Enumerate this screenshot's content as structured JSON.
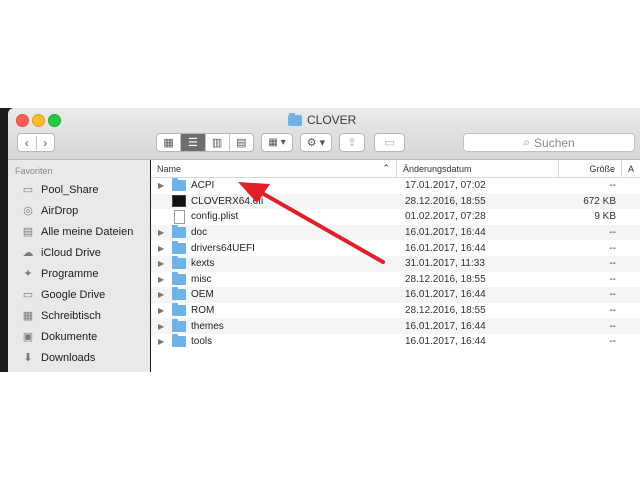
{
  "window": {
    "title": "CLOVER"
  },
  "toolbar": {
    "back": "‹",
    "forward": "›",
    "search_placeholder": "Suchen"
  },
  "sidebar": {
    "heading": "Favoriten",
    "items": [
      {
        "label": "Pool_Share",
        "icon": "folder-icon"
      },
      {
        "label": "AirDrop",
        "icon": "airdrop-icon"
      },
      {
        "label": "Alle meine Dateien",
        "icon": "all-files-icon"
      },
      {
        "label": "iCloud Drive",
        "icon": "cloud-icon"
      },
      {
        "label": "Programme",
        "icon": "applications-icon"
      },
      {
        "label": "Google Drive",
        "icon": "folder-icon"
      },
      {
        "label": "Schreibtisch",
        "icon": "desktop-icon"
      },
      {
        "label": "Dokumente",
        "icon": "documents-icon"
      },
      {
        "label": "Downloads",
        "icon": "downloads-icon"
      }
    ]
  },
  "columns": {
    "name": "Name",
    "date": "Änderungsdatum",
    "size": "Größe",
    "kind": "A"
  },
  "files": [
    {
      "name": "ACPI",
      "date": "17.01.2017, 07:02",
      "size": "--",
      "type": "folder",
      "expandable": true
    },
    {
      "name": "CLOVERX64.efi",
      "date": "28.12.2016, 18:55",
      "size": "672 KB",
      "type": "exec",
      "expandable": false
    },
    {
      "name": "config.plist",
      "date": "01.02.2017, 07:28",
      "size": "9 KB",
      "type": "file",
      "expandable": false
    },
    {
      "name": "doc",
      "date": "16.01.2017, 16:44",
      "size": "--",
      "type": "folder",
      "expandable": true
    },
    {
      "name": "drivers64UEFI",
      "date": "16.01.2017, 16:44",
      "size": "--",
      "type": "folder",
      "expandable": true
    },
    {
      "name": "kexts",
      "date": "31.01.2017, 11:33",
      "size": "--",
      "type": "folder",
      "expandable": true
    },
    {
      "name": "misc",
      "date": "28.12.2016, 18:55",
      "size": "--",
      "type": "folder",
      "expandable": true
    },
    {
      "name": "OEM",
      "date": "16.01.2017, 16:44",
      "size": "--",
      "type": "folder",
      "expandable": true
    },
    {
      "name": "ROM",
      "date": "28.12.2016, 18:55",
      "size": "--",
      "type": "folder",
      "expandable": true
    },
    {
      "name": "themes",
      "date": "16.01.2017, 16:44",
      "size": "--",
      "type": "folder",
      "expandable": true
    },
    {
      "name": "tools",
      "date": "16.01.2017, 16:44",
      "size": "--",
      "type": "folder",
      "expandable": true
    }
  ],
  "colors": {
    "annotation_arrow": "#e0202a",
    "folder": "#6fb2e8",
    "sidebar_bg": "#e9e8ea"
  }
}
